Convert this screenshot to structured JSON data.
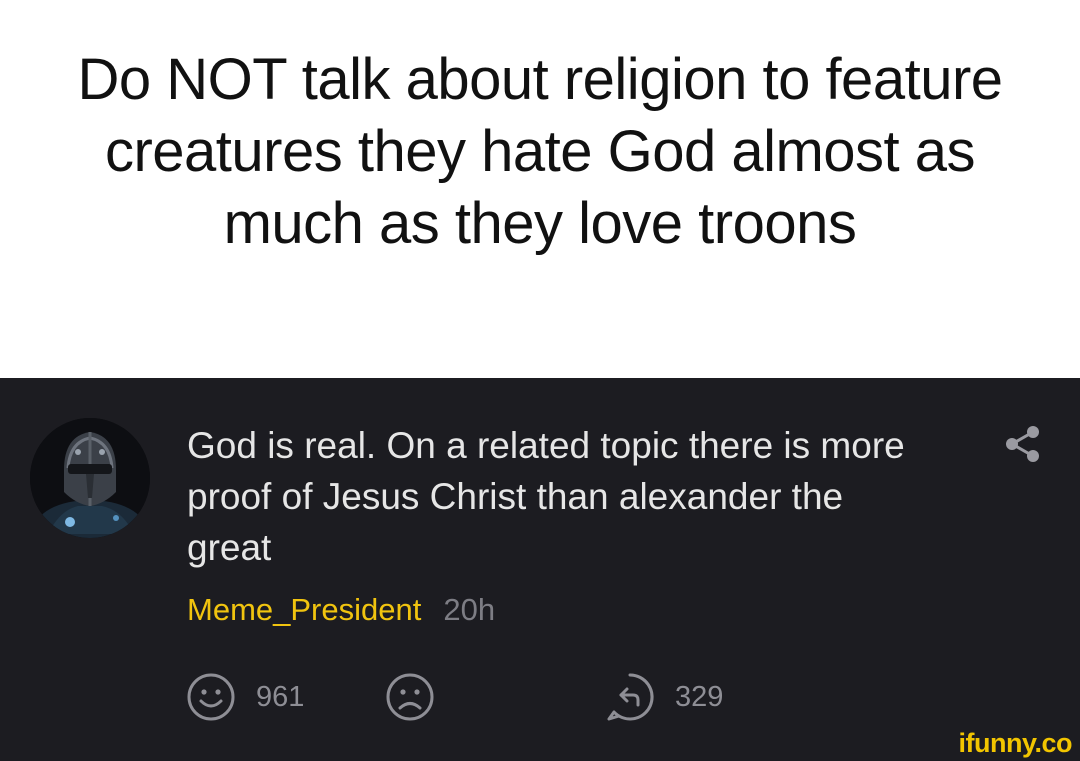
{
  "caption": {
    "text": "Do NOT talk about religion to feature creatures they hate God almost as much as they love troons"
  },
  "comment": {
    "text": "God is real. On a related topic there is more proof of Jesus Christ than alexander the great",
    "username": "Meme_President",
    "timestamp": "20h",
    "avatar_icon": "helmeted-warrior-avatar",
    "share_icon": "share-icon"
  },
  "actions": {
    "smile_icon": "smile-icon",
    "smile_count": "961",
    "frown_icon": "frown-icon",
    "reply_icon": "reply-icon",
    "reply_count": "329"
  },
  "watermark": {
    "text": "ifunny.co"
  },
  "colors": {
    "card_background": "#1c1c21",
    "username": "#f1c40f",
    "watermark": "#f2c500",
    "icon_gray": "#8e8e95"
  }
}
